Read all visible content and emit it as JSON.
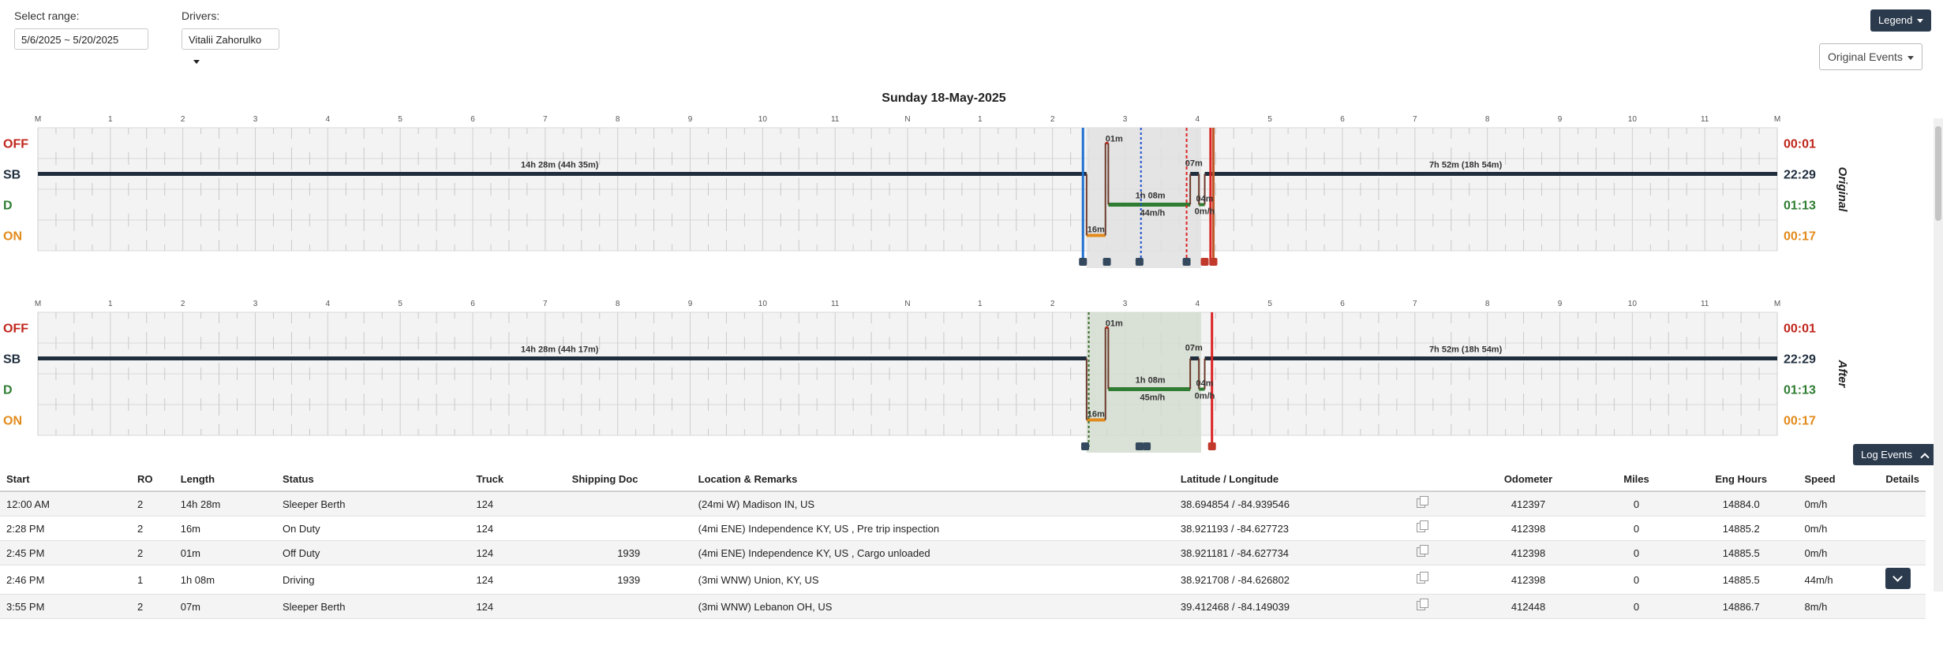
{
  "controls": {
    "range_label": "Select range:",
    "range_value": "5/6/2025 ~ 5/20/2025",
    "drivers_label": "Drivers:",
    "driver_value": "Vitalii Zahorulko",
    "legend_button": "Legend",
    "original_events": "Original Events",
    "log_events_button": "Log Events"
  },
  "chart_title": "Sunday 18-May-2025",
  "hour_labels": [
    "M",
    "1",
    "2",
    "3",
    "4",
    "5",
    "6",
    "7",
    "8",
    "9",
    "10",
    "11",
    "N",
    "1",
    "2",
    "3",
    "4",
    "5",
    "6",
    "7",
    "8",
    "9",
    "10",
    "11",
    "M"
  ],
  "status_labels": [
    "OFF",
    "SB",
    "D",
    "ON"
  ],
  "status_colors": {
    "OFF": "#c0261c",
    "SB": "#1f2d3d",
    "D": "#2f7d32",
    "ON": "#e28a1b"
  },
  "charts": [
    {
      "side_label": "Original",
      "totals": [
        "00:01",
        "22:29",
        "01:13",
        "00:17"
      ],
      "annotations": [
        "14h 28m (44h 35m)",
        "7h 52m (18h 54m)",
        "01m",
        "07m",
        "16m",
        "1h 08m",
        "44m/h",
        "04m",
        "0m/h"
      ]
    },
    {
      "side_label": "After",
      "totals": [
        "00:01",
        "22:29",
        "01:13",
        "00:17"
      ],
      "annotations": [
        "14h 28m (44h 17m)",
        "7h 52m (18h 54m)",
        "01m",
        "07m",
        "16m",
        "1h 08m",
        "45m/h",
        "04m",
        "0m/h"
      ]
    }
  ],
  "table": {
    "headers": [
      "Start",
      "RO",
      "Length",
      "Status",
      "Truck",
      "Shipping Doc",
      "Location & Remarks",
      "Latitude / Longitude",
      "",
      "Odometer",
      "Miles",
      "Eng Hours",
      "Speed",
      "Details"
    ],
    "rows": [
      [
        "12:00 AM",
        "2",
        "14h 28m",
        "Sleeper Berth",
        "124",
        "",
        "(24mi W) Madison IN, US",
        "38.694854 / -84.939546",
        "412397",
        "0",
        "14884.0",
        "0m/h"
      ],
      [
        "2:28 PM",
        "2",
        "16m",
        "On Duty",
        "124",
        "",
        "(4mi ENE) Independence KY, US , Pre trip inspection",
        "38.921193 / -84.627723",
        "412398",
        "0",
        "14885.2",
        "0m/h"
      ],
      [
        "2:45 PM",
        "2",
        "01m",
        "Off Duty",
        "124",
        "1939",
        "(4mi ENE) Independence KY, US , Cargo unloaded",
        "38.921181 / -84.627734",
        "412398",
        "0",
        "14885.5",
        "0m/h"
      ],
      [
        "2:46 PM",
        "1",
        "1h 08m",
        "Driving",
        "124",
        "1939",
        "(3mi WNW) Union, KY, US",
        "38.921708 / -84.626802",
        "412398",
        "0",
        "14885.5",
        "44m/h"
      ],
      [
        "3:55 PM",
        "2",
        "07m",
        "Sleeper Berth",
        "124",
        "",
        "(3mi WNW) Lebanon OH, US",
        "39.412468 / -84.149039",
        "412448",
        "0",
        "14886.7",
        "8m/h"
      ]
    ]
  }
}
